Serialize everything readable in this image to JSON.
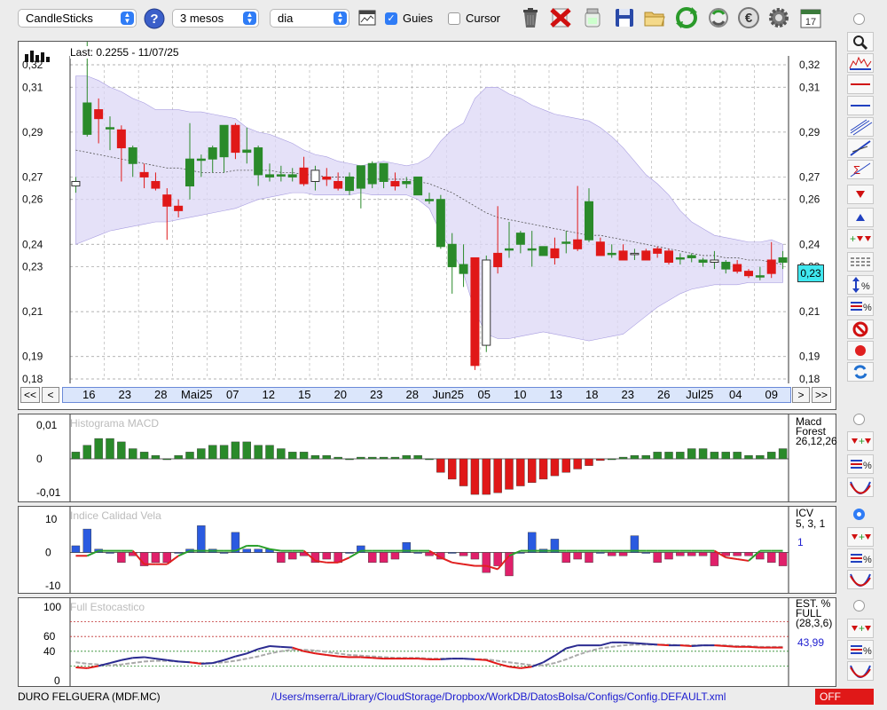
{
  "toolbar": {
    "chart_type": "CandleSticks",
    "period": "3 mesos",
    "interval": "dia",
    "guides_label": "Guies",
    "guides_checked": true,
    "cursor_label": "Cursor",
    "cursor_checked": false,
    "icons": [
      "help-icon",
      "chart-window-icon",
      "trash-icon",
      "delete-icon",
      "jar-icon",
      "save-icon",
      "folder-icon",
      "refresh-icon",
      "refresh-alt-icon",
      "euro-icon",
      "gear-icon",
      "calendar-icon"
    ],
    "calendar_day": "17"
  },
  "main_chart": {
    "last_label": "Last: 0.2255 - 11/07/25",
    "price_badge": "0,23",
    "y_ticks": [
      "0,32",
      "0,31",
      "0,29",
      "0,27",
      "0,26",
      "0,24",
      "0,23",
      "0,21",
      "0,19",
      "0,18"
    ],
    "x_ticks": [
      "16",
      "23",
      "28",
      "Mai25",
      "07",
      "12",
      "15",
      "20",
      "23",
      "28",
      "Jun25",
      "05",
      "10",
      "13",
      "18",
      "23",
      "26",
      "Jul25",
      "04",
      "09"
    ],
    "nav_buttons": [
      "<<",
      "<",
      ">",
      ">>"
    ]
  },
  "chart_data": [
    {
      "type": "candlestick",
      "title": "Last: 0.2255 - 11/07/25",
      "ylim": [
        0.18,
        0.32
      ],
      "colors": {
        "up": "#2a8a2a",
        "down": "#e01818",
        "band": "#dcd7f6"
      },
      "candles": [
        [
          0.266,
          0.27,
          0.263,
          0.268
        ],
        [
          0.289,
          0.335,
          0.288,
          0.303
        ],
        [
          0.3,
          0.305,
          0.285,
          0.296
        ],
        [
          0.292,
          0.297,
          0.282,
          0.292
        ],
        [
          0.291,
          0.293,
          0.268,
          0.283
        ],
        [
          0.276,
          0.284,
          0.27,
          0.283
        ],
        [
          0.272,
          0.276,
          0.265,
          0.27
        ],
        [
          0.268,
          0.272,
          0.264,
          0.265
        ],
        [
          0.262,
          0.265,
          0.242,
          0.257
        ],
        [
          0.257,
          0.26,
          0.252,
          0.255
        ],
        [
          0.266,
          0.294,
          0.26,
          0.278
        ],
        [
          0.278,
          0.28,
          0.27,
          0.278
        ],
        [
          0.278,
          0.284,
          0.272,
          0.283
        ],
        [
          0.279,
          0.293,
          0.272,
          0.293
        ],
        [
          0.293,
          0.294,
          0.278,
          0.281
        ],
        [
          0.281,
          0.292,
          0.276,
          0.282
        ],
        [
          0.271,
          0.284,
          0.266,
          0.283
        ],
        [
          0.27,
          0.276,
          0.268,
          0.271
        ],
        [
          0.271,
          0.275,
          0.268,
          0.271
        ],
        [
          0.27,
          0.274,
          0.268,
          0.271
        ],
        [
          0.274,
          0.279,
          0.266,
          0.267
        ],
        [
          0.268,
          0.275,
          0.264,
          0.273
        ],
        [
          0.27,
          0.274,
          0.266,
          0.269
        ],
        [
          0.268,
          0.272,
          0.264,
          0.265
        ],
        [
          0.264,
          0.272,
          0.262,
          0.27
        ],
        [
          0.265,
          0.275,
          0.256,
          0.275
        ],
        [
          0.267,
          0.277,
          0.265,
          0.276
        ],
        [
          0.268,
          0.276,
          0.265,
          0.276
        ],
        [
          0.268,
          0.272,
          0.264,
          0.266
        ],
        [
          0.267,
          0.27,
          0.265,
          0.268
        ],
        [
          0.262,
          0.27,
          0.262,
          0.27
        ],
        [
          0.26,
          0.263,
          0.258,
          0.26
        ],
        [
          0.239,
          0.262,
          0.238,
          0.26
        ],
        [
          0.23,
          0.245,
          0.218,
          0.24
        ],
        [
          0.227,
          0.24,
          0.221,
          0.231
        ],
        [
          0.234,
          0.234,
          0.184,
          0.186
        ],
        [
          0.195,
          0.235,
          0.192,
          0.233
        ],
        [
          0.236,
          0.257,
          0.227,
          0.23
        ],
        [
          0.238,
          0.25,
          0.234,
          0.238
        ],
        [
          0.24,
          0.246,
          0.236,
          0.245
        ],
        [
          0.238,
          0.246,
          0.23,
          0.238
        ],
        [
          0.235,
          0.239,
          0.235,
          0.239
        ],
        [
          0.238,
          0.243,
          0.231,
          0.234
        ],
        [
          0.241,
          0.246,
          0.236,
          0.241
        ],
        [
          0.242,
          0.266,
          0.237,
          0.238
        ],
        [
          0.242,
          0.265,
          0.241,
          0.259
        ],
        [
          0.241,
          0.243,
          0.236,
          0.235
        ],
        [
          0.236,
          0.24,
          0.234,
          0.236
        ],
        [
          0.237,
          0.24,
          0.233,
          0.233
        ],
        [
          0.236,
          0.238,
          0.233,
          0.236
        ],
        [
          0.237,
          0.238,
          0.233,
          0.233
        ],
        [
          0.238,
          0.239,
          0.234,
          0.236
        ],
        [
          0.237,
          0.238,
          0.231,
          0.232
        ],
        [
          0.234,
          0.236,
          0.231,
          0.234
        ],
        [
          0.234,
          0.236,
          0.232,
          0.235
        ],
        [
          0.232,
          0.234,
          0.23,
          0.233
        ],
        [
          0.232,
          0.237,
          0.229,
          0.233
        ],
        [
          0.229,
          0.233,
          0.227,
          0.232
        ],
        [
          0.231,
          0.233,
          0.227,
          0.228
        ],
        [
          0.228,
          0.229,
          0.225,
          0.226
        ],
        [
          0.226,
          0.23,
          0.224,
          0.226
        ],
        [
          0.233,
          0.241,
          0.225,
          0.227
        ],
        [
          0.232,
          0.237,
          0.229,
          0.234
        ]
      ],
      "band_upper": [
        0.315,
        0.315,
        0.313,
        0.31,
        0.308,
        0.305,
        0.303,
        0.3,
        0.3,
        0.3,
        0.299,
        0.299,
        0.298,
        0.297,
        0.296,
        0.292,
        0.29,
        0.289,
        0.287,
        0.285,
        0.282,
        0.28,
        0.279,
        0.277,
        0.276,
        0.275,
        0.276,
        0.277,
        0.276,
        0.275,
        0.276,
        0.279,
        0.286,
        0.291,
        0.294,
        0.305,
        0.31,
        0.31,
        0.307,
        0.305,
        0.302,
        0.3,
        0.298,
        0.297,
        0.296,
        0.295,
        0.292,
        0.288,
        0.283,
        0.277,
        0.271,
        0.267,
        0.262,
        0.255,
        0.25,
        0.247,
        0.244,
        0.243,
        0.242,
        0.241,
        0.241,
        0.242,
        0.24
      ],
      "band_mid": [
        0.282,
        0.281,
        0.28,
        0.279,
        0.278,
        0.277,
        0.276,
        0.275,
        0.274,
        0.274,
        0.273,
        0.272,
        0.272,
        0.272,
        0.273,
        0.273,
        0.273,
        0.273,
        0.272,
        0.272,
        0.271,
        0.271,
        0.27,
        0.27,
        0.27,
        0.269,
        0.269,
        0.269,
        0.269,
        0.269,
        0.268,
        0.267,
        0.265,
        0.263,
        0.26,
        0.257,
        0.254,
        0.252,
        0.251,
        0.25,
        0.249,
        0.248,
        0.247,
        0.246,
        0.245,
        0.244,
        0.244,
        0.243,
        0.242,
        0.241,
        0.24,
        0.239,
        0.238,
        0.237,
        0.236,
        0.235,
        0.235,
        0.234,
        0.234,
        0.233,
        0.233,
        0.232,
        0.231
      ],
      "band_lower": [
        0.24,
        0.242,
        0.244,
        0.246,
        0.247,
        0.248,
        0.249,
        0.25,
        0.25,
        0.251,
        0.252,
        0.253,
        0.254,
        0.255,
        0.256,
        0.258,
        0.26,
        0.261,
        0.262,
        0.263,
        0.263,
        0.262,
        0.262,
        0.262,
        0.262,
        0.263,
        0.262,
        0.262,
        0.262,
        0.262,
        0.26,
        0.256,
        0.245,
        0.237,
        0.227,
        0.21,
        0.2,
        0.198,
        0.198,
        0.199,
        0.2,
        0.201,
        0.2,
        0.199,
        0.198,
        0.197,
        0.198,
        0.199,
        0.2,
        0.204,
        0.208,
        0.212,
        0.215,
        0.218,
        0.22,
        0.221,
        0.222,
        0.222,
        0.222,
        0.223,
        0.223,
        0.223,
        0.223
      ]
    },
    {
      "type": "bar",
      "title": "Histograma MACD",
      "legend": [
        "Macd",
        "Forest",
        "26,12,26"
      ],
      "y_ticks": [
        "0,01",
        "0",
        "-0,01"
      ],
      "ylim": [
        -0.011,
        0.011
      ],
      "values": [
        0.002,
        0.004,
        0.006,
        0.006,
        0.005,
        0.003,
        0.002,
        0.001,
        0,
        0.001,
        0.002,
        0.003,
        0.004,
        0.004,
        0.005,
        0.005,
        0.004,
        0.004,
        0.003,
        0.002,
        0.002,
        0.001,
        0.001,
        0.0005,
        0,
        0.0005,
        0.0005,
        0.0005,
        0.0005,
        0.001,
        0.001,
        0,
        -0.004,
        -0.006,
        -0.008,
        -0.0105,
        -0.0105,
        -0.01,
        -0.009,
        -0.008,
        -0.007,
        -0.006,
        -0.005,
        -0.004,
        -0.003,
        -0.002,
        -0.0005,
        0,
        0.0005,
        0.001,
        0.001,
        0.002,
        0.002,
        0.002,
        0.003,
        0.003,
        0.002,
        0.002,
        0.002,
        0.001,
        0.001,
        0.002,
        0.003
      ]
    },
    {
      "type": "bar",
      "title": "Indice Calidad Vela",
      "legend": [
        "ICV",
        "5, 3, 1"
      ],
      "current_value": "1",
      "y_ticks": [
        "10",
        "0",
        "-10"
      ],
      "ylim": [
        -11,
        11
      ],
      "values": [
        2,
        7,
        1,
        0,
        -3,
        -1,
        -4,
        -3,
        -3,
        0,
        1,
        8,
        1,
        0,
        6,
        1,
        1,
        1,
        -3,
        -2,
        -1,
        -3,
        -2,
        -3,
        0,
        2,
        -3,
        -3,
        -2,
        3,
        0,
        -1,
        -2,
        0,
        -1,
        -2,
        -6,
        -4,
        -7,
        0,
        6,
        1,
        4,
        -3,
        -2,
        -3,
        0,
        -1,
        -1,
        5,
        0,
        -3,
        -2,
        -1,
        -1,
        -1,
        -4,
        -1,
        -1,
        -1,
        -2,
        -3,
        -4,
        3,
        1
      ],
      "line": [
        -1,
        -1,
        0.5,
        0.5,
        0.5,
        0.5,
        -3.5,
        -3.5,
        -3.5,
        -1,
        0.5,
        0.5,
        0.5,
        0.5,
        0.5,
        2,
        2,
        1,
        0.5,
        0.5,
        0.5,
        -2.5,
        -3,
        -3,
        -1.5,
        0.5,
        0.5,
        0.5,
        0.5,
        0.5,
        0.5,
        0.5,
        -1.5,
        -3,
        -3.5,
        -4,
        -4,
        -5,
        -1,
        0.5,
        0.5,
        0.5,
        0.5,
        0.5,
        0.5,
        0.5,
        0.5,
        0.5,
        0.5,
        0.5,
        0.5,
        0.5,
        0.5,
        0.5,
        0.5,
        0.5,
        0.5,
        -1.5,
        -2,
        -2.5,
        0.5,
        0.5,
        0.5
      ]
    },
    {
      "type": "line",
      "title": "Full Estocastico",
      "legend": [
        "EST. %",
        "FULL",
        "(28,3,6)"
      ],
      "current_value": "43,99",
      "y_ticks": [
        "100",
        "60",
        "40",
        "0"
      ],
      "ylim": [
        0,
        100
      ],
      "series": [
        {
          "values": [
            18,
            17,
            20,
            24,
            28,
            31,
            32,
            30,
            28,
            26,
            25,
            23,
            24,
            28,
            33,
            37,
            43,
            47,
            46,
            45,
            40,
            37,
            35,
            33,
            32,
            32,
            31,
            30,
            30,
            30,
            30,
            29,
            29,
            30,
            30,
            29,
            28,
            23,
            19,
            17,
            19,
            25,
            34,
            44,
            48,
            48,
            48,
            52,
            52,
            51,
            50,
            49,
            48,
            48,
            47,
            48,
            48,
            47,
            46,
            46,
            45,
            45,
            45
          ]
        },
        {
          "values": [
            25,
            23,
            22,
            21,
            22,
            24,
            26,
            27,
            27,
            26,
            25,
            24,
            24,
            25,
            27,
            30,
            33,
            37,
            40,
            42,
            42,
            41,
            39,
            37,
            35,
            34,
            33,
            32,
            31,
            31,
            31,
            30,
            30,
            30,
            30,
            29,
            29,
            27,
            25,
            23,
            21,
            21,
            24,
            29,
            35,
            40,
            44,
            46,
            48,
            49,
            49,
            49,
            49,
            48,
            48,
            48,
            48,
            48,
            47,
            47,
            46,
            46,
            46
          ]
        }
      ],
      "reference_lines": [
        80,
        60,
        40,
        20
      ]
    }
  ],
  "statusbar": {
    "instrument": "DURO FELGUERA (MDF.MC)",
    "config_path": "/Users/mserra/Library/CloudStorage/Dropbox/WorkDB/DatosBolsa/Configs/Config.DEFAULT.xml",
    "state": "OFF"
  }
}
